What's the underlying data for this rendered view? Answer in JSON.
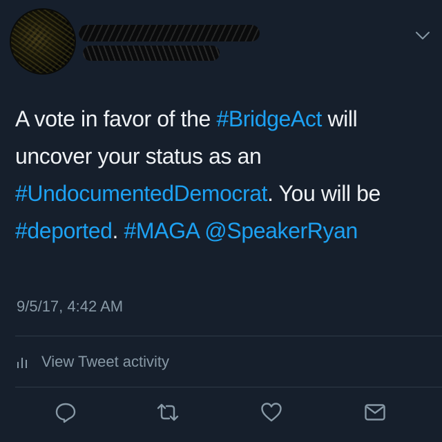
{
  "tweet": {
    "text_segments": [
      {
        "text": "A vote in favor of the ",
        "type": "text"
      },
      {
        "text": "#BridgeAct",
        "type": "hashtag"
      },
      {
        "text": " will uncover your status as an ",
        "type": "text"
      },
      {
        "text": "#UndocumentedDemocrat",
        "type": "hashtag"
      },
      {
        "text": ".  You will be ",
        "type": "text"
      },
      {
        "text": "#deported",
        "type": "hashtag"
      },
      {
        "text": ". ",
        "type": "text"
      },
      {
        "text": "#MAGA",
        "type": "hashtag"
      },
      {
        "text": " ",
        "type": "text"
      },
      {
        "text": "@SpeakerRyan",
        "type": "mention"
      }
    ],
    "timestamp": "9/5/17, 4:42 AM"
  },
  "activity": {
    "label": "View Tweet activity",
    "icon": "activity-bars-icon"
  },
  "actions": [
    {
      "name": "reply",
      "icon": "reply-icon"
    },
    {
      "name": "retweet",
      "icon": "retweet-icon"
    },
    {
      "name": "like",
      "icon": "heart-icon"
    },
    {
      "name": "direct-message",
      "icon": "envelope-icon"
    }
  ],
  "colors": {
    "background": "#161f2c",
    "text": "#eef1f4",
    "link": "#1da1f2",
    "muted": "#8899a6",
    "divider": "#2f3b48"
  }
}
